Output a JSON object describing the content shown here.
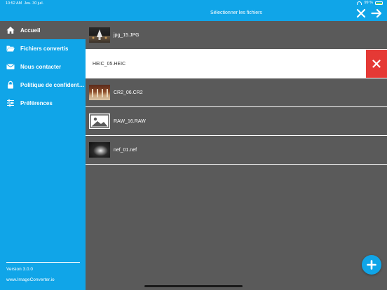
{
  "status_bar": {
    "time": "10:52 AM",
    "date": "Jeu. 30 juil.",
    "battery": "99 %",
    "wifi_icon": "wifi-icon",
    "battery_icon": "battery-icon"
  },
  "header": {
    "title": "Sélectionner les fichiers",
    "close_icon": "close-icon",
    "next_icon": "arrow-right-icon"
  },
  "sidebar": {
    "items": [
      {
        "label": "Accueil",
        "icon": "home-icon",
        "active": true
      },
      {
        "label": "Fichiers convertis",
        "icon": "folder-icon",
        "active": false
      },
      {
        "label": "Nous contacter",
        "icon": "envelope-icon",
        "active": false
      },
      {
        "label": "Politique de confidenti...",
        "icon": "lock-icon",
        "active": false
      },
      {
        "label": "Préférences",
        "icon": "sliders-icon",
        "active": false
      }
    ],
    "version": "Version 3.0.0",
    "website": "www.ImageConverter.io"
  },
  "files": [
    {
      "name": "jpg_15.JPG",
      "thumb": "photo-thumbnail",
      "selected": false
    },
    {
      "name": "HEIC_05.HEIC",
      "thumb": "none",
      "selected": true
    },
    {
      "name": "CR2_06.CR2",
      "thumb": "photo-thumbnail",
      "selected": false
    },
    {
      "name": "RAW_16.RAW",
      "thumb": "image-placeholder-icon",
      "selected": false
    },
    {
      "name": "nef_01.nef",
      "thumb": "photo-thumbnail",
      "selected": false
    }
  ],
  "actions": {
    "delete_icon": "delete-x-icon",
    "add_icon": "plus-icon"
  },
  "colors": {
    "accent": "#10a5e8",
    "background": "#5a5a5a",
    "delete": "#e53935"
  }
}
